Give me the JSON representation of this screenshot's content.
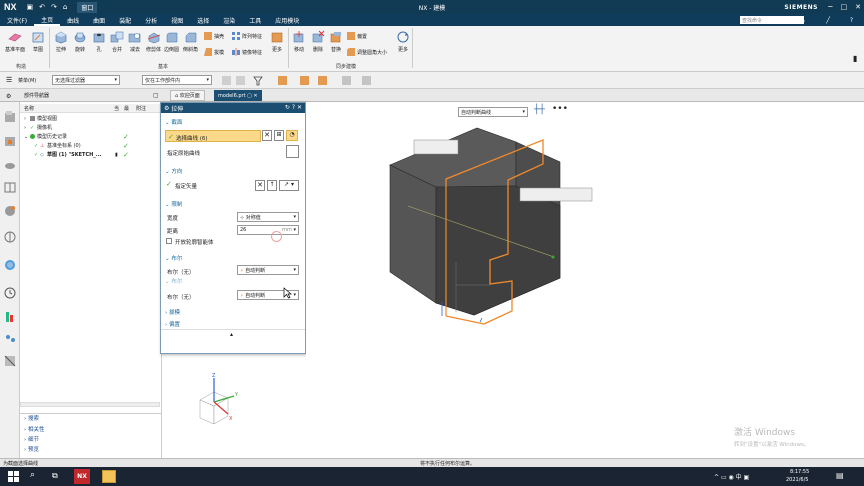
{
  "titlebar": {
    "logo": "NX",
    "window_menu": "窗口",
    "title": "NX - 建模",
    "brand": "SIEMENS"
  },
  "menubar": {
    "items": [
      "文件(F)",
      "主页",
      "曲线",
      "曲面",
      "装配",
      "分析",
      "视图",
      "选择",
      "渲染",
      "工具",
      "应用模块"
    ],
    "search_placeholder": "查找命令"
  },
  "ribbon": {
    "buttons": [
      "基准平面",
      "草图",
      "拉伸",
      "旋转",
      "孔",
      "合并",
      "减去",
      "修剪体",
      "边倒圆",
      "倒斜角",
      "抽壳",
      "拔模",
      "阵列特征",
      "镜像特征",
      "更多",
      "移动",
      "删除",
      "替换",
      "偏置",
      "调整圆角大小",
      "更多"
    ],
    "small": {
      "shell": "抽壳",
      "draft": "拔模",
      "pattern": "阵列特征",
      "mirror": "镜像特征",
      "offset": "偏置",
      "resize": "调整圆角大小"
    },
    "groups": [
      "构造",
      "基本",
      "同步建模"
    ]
  },
  "selbar": {
    "menu": "菜单(M)",
    "filter": "无选择过滤器",
    "scope": "仅在工作部件内"
  },
  "tabs": {
    "navigator": "部件导航器",
    "welcome": "欢迎页面",
    "model": "model6.prt"
  },
  "navigator": {
    "col_name": "名称",
    "col_cur": "当",
    "col_latest": "最",
    "col_note": "附注",
    "rows": [
      "模型视图",
      "摄像机",
      "模型历史记录",
      "基准坐标系 (0)",
      "草图 (1) \"SKETCH_..."
    ],
    "bottom_sections": [
      "搜索",
      "相关性",
      "细节",
      "预览"
    ]
  },
  "dialog": {
    "title": "拉伸",
    "sections": {
      "section": "截面",
      "direction": "方向",
      "limits": "限制",
      "bool": "布尔",
      "offset": "偏置",
      "draft": "拔模",
      "settings": "偏置"
    },
    "select_curve": "选择曲线 (6)",
    "origin_curve": "指定原始曲线",
    "vector": "指定矢量",
    "width_label": "宽度",
    "width_value": "对称值",
    "distance_label": "距离",
    "distance_value": "26",
    "distance_unit": "mm",
    "open_profile": "开放轮廓智能体",
    "bool_label": "布尔（无）",
    "bool_value": "自动判断",
    "bool2_label": "布尔（无）",
    "bool2_value": "自动判断",
    "bool2_section": "布尔"
  },
  "viewport": {
    "curve_rule": "自动判断曲线"
  },
  "statusbar": {
    "left": "为截面选择曲线",
    "center": "将不执行任何布尔运算。"
  },
  "watermark": {
    "line1": "激活 Windows",
    "line2": "转到\"设置\"以激活 Windows。"
  },
  "taskbar": {
    "time": "8:17:55",
    "date": "2021/6/5"
  },
  "colors": {
    "title_bg": "#113a55",
    "accent": "#f0892b",
    "body": "#4a4a4a",
    "check": "#3aaa35"
  }
}
